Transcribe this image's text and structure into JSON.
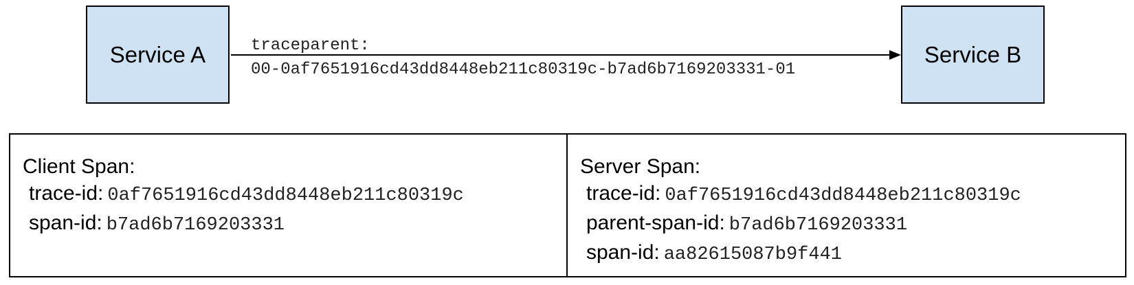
{
  "colors": {
    "service_fill": "#cfe2f3",
    "stroke": "#000000",
    "mono_text": "#222222"
  },
  "services": {
    "a": {
      "label": "Service A"
    },
    "b": {
      "label": "Service B"
    }
  },
  "header": {
    "name": "traceparent:",
    "value": "00-0af7651916cd43dd8448eb211c80319c-b7ad6b7169203331-01"
  },
  "client_span": {
    "title": "Client Span:",
    "fields": [
      {
        "label": "trace-id:",
        "value": "0af7651916cd43dd8448eb211c80319c"
      },
      {
        "label": "span-id:",
        "value": "b7ad6b7169203331"
      }
    ]
  },
  "server_span": {
    "title": "Server Span:",
    "fields": [
      {
        "label": "trace-id:",
        "value": "0af7651916cd43dd8448eb211c80319c"
      },
      {
        "label": "parent-span-id:",
        "value": "b7ad6b7169203331"
      },
      {
        "label": "span-id:",
        "value": "aa82615087b9f441"
      }
    ]
  }
}
